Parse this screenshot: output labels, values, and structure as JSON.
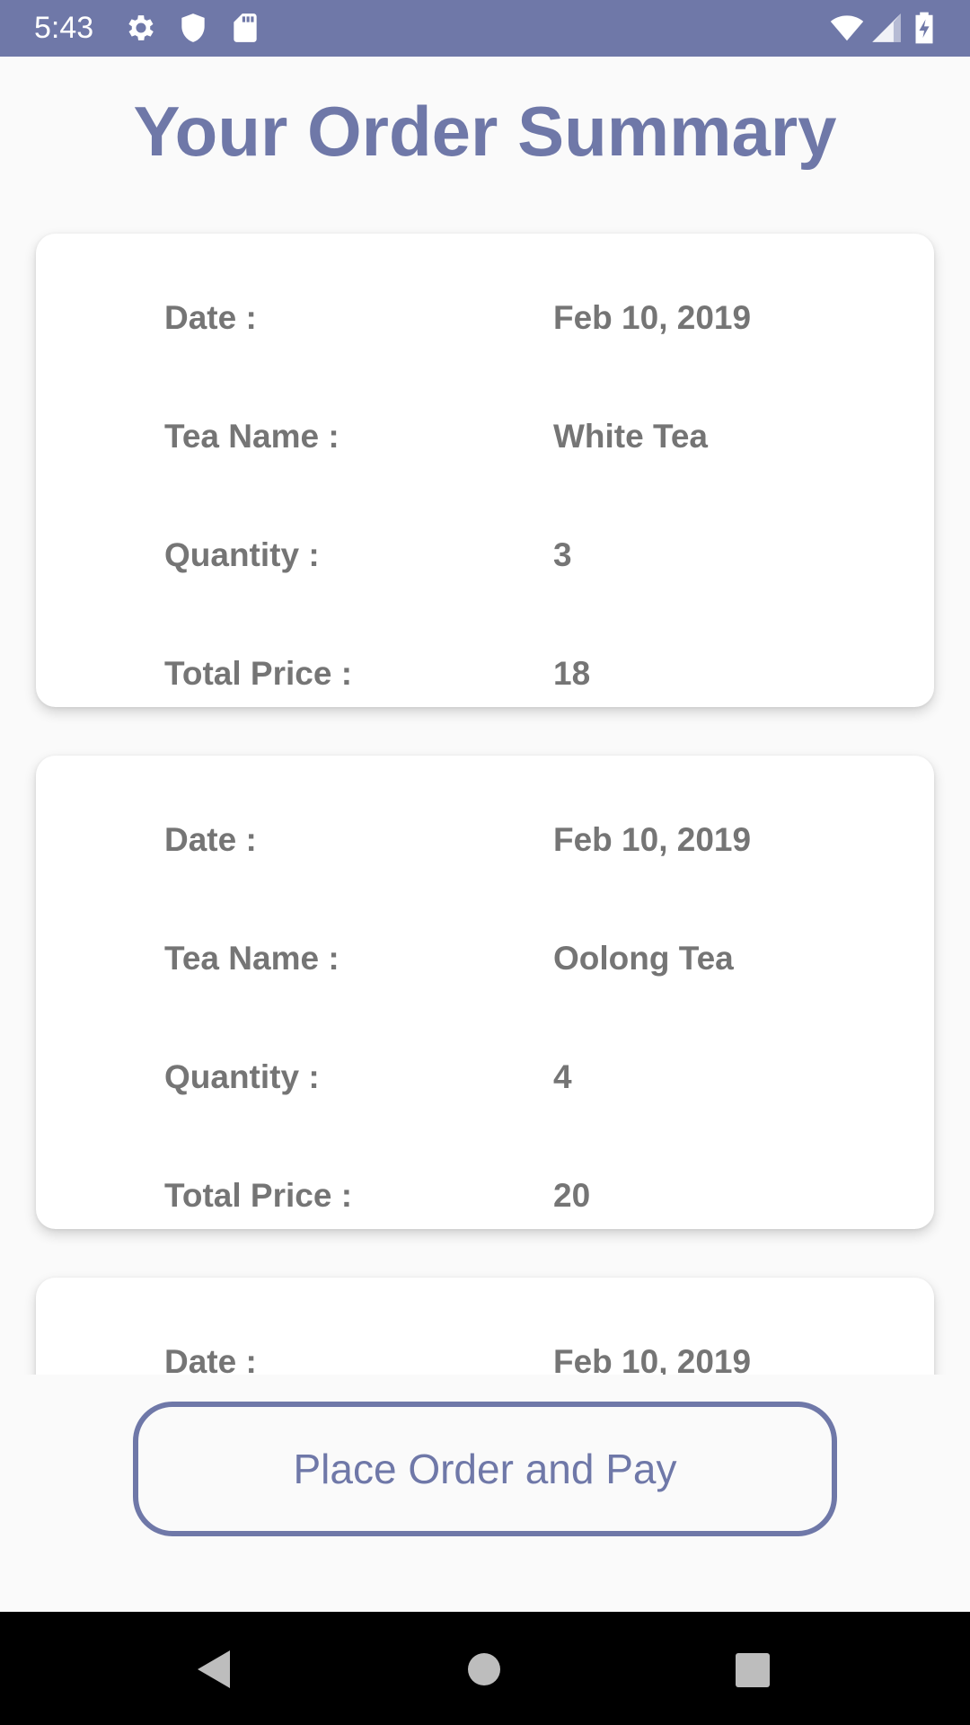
{
  "status_bar": {
    "time": "5:43",
    "icons_left": [
      "gear-icon",
      "shield-icon",
      "sd-card-icon"
    ],
    "icons_right": [
      "wifi-icon",
      "cellular-signal-icon",
      "battery-charging-icon"
    ]
  },
  "page": {
    "title": "Your Order Summary"
  },
  "orders": [
    {
      "date_label": "Date :",
      "date": "Feb 10, 2019",
      "tea_label": "Tea Name :",
      "tea_name": "White Tea",
      "qty_label": "Quantity :",
      "quantity": "3",
      "price_label": "Total Price :",
      "total_price": "18"
    },
    {
      "date_label": "Date :",
      "date": "Feb 10, 2019",
      "tea_label": "Tea Name :",
      "tea_name": "Oolong Tea",
      "qty_label": "Quantity :",
      "quantity": "4",
      "price_label": "Total Price :",
      "total_price": "20"
    },
    {
      "date_label": "Date :",
      "date": "Feb 10, 2019"
    }
  ],
  "actions": {
    "place_order_label": "Place Order and Pay"
  },
  "nav_bar": {
    "buttons": [
      "back-icon",
      "home-icon",
      "recents-icon"
    ]
  },
  "colors": {
    "accent": "#6f78a8",
    "label_text": "#757575",
    "card_bg": "#ffffff",
    "page_bg": "#fafafa"
  }
}
